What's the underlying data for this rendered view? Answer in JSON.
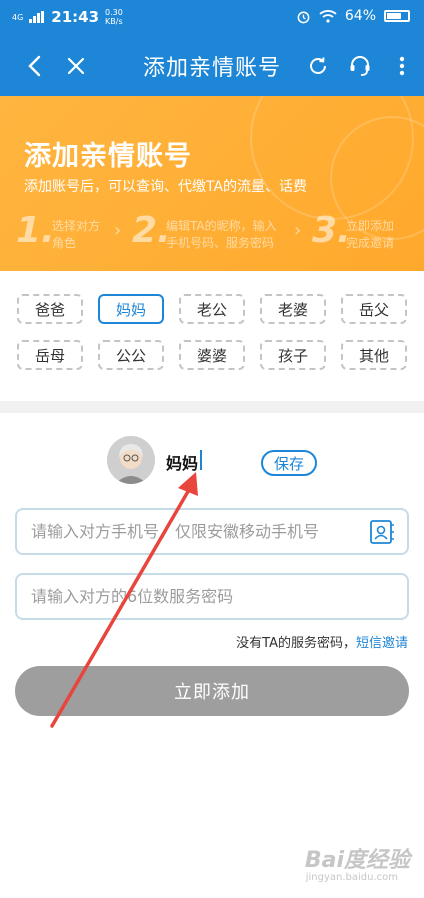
{
  "status_bar": {
    "network": "4G",
    "time": "21:43",
    "speed_value": "0.30",
    "speed_unit": "KB/s",
    "battery": "64%"
  },
  "nav": {
    "title": "添加亲情账号",
    "icons": [
      "back-icon",
      "close-icon",
      "refresh-icon",
      "customer-service-icon",
      "more-icon"
    ]
  },
  "banner": {
    "title": "添加亲情账号",
    "subtitle": "添加账号后，可以查询、代缴TA的流量、话费",
    "steps": [
      {
        "num": "1.",
        "line1": "选择对方",
        "line2": "角色"
      },
      {
        "num": "2.",
        "line1": "编辑TA的昵称，输入",
        "line2": "手机号码、服务密码"
      },
      {
        "num": "3.",
        "line1": "立即添加",
        "line2": "完成邀请"
      }
    ]
  },
  "roles": {
    "options": [
      "爸爸",
      "妈妈",
      "老公",
      "老婆",
      "岳父",
      "岳母",
      "公公",
      "婆婆",
      "孩子",
      "其他"
    ],
    "selected": "妈妈"
  },
  "form": {
    "nickname": "妈妈",
    "save_label": "保存",
    "phone_placeholder": "请输入对方手机号，仅限安徽移动手机号",
    "password_placeholder": "请输入对方的6位数服务密码",
    "hint_text": "没有TA的服务密码，",
    "hint_link": "短信邀请",
    "submit_label": "立即添加"
  },
  "watermark": {
    "text": "Bai度经验",
    "sub": "jingyan.baidu.com"
  },
  "colors": {
    "primary": "#1e86d6",
    "banner": "#ffad33",
    "disabled_button": "#9e9e9e",
    "annotation_arrow": "#e8453c"
  }
}
